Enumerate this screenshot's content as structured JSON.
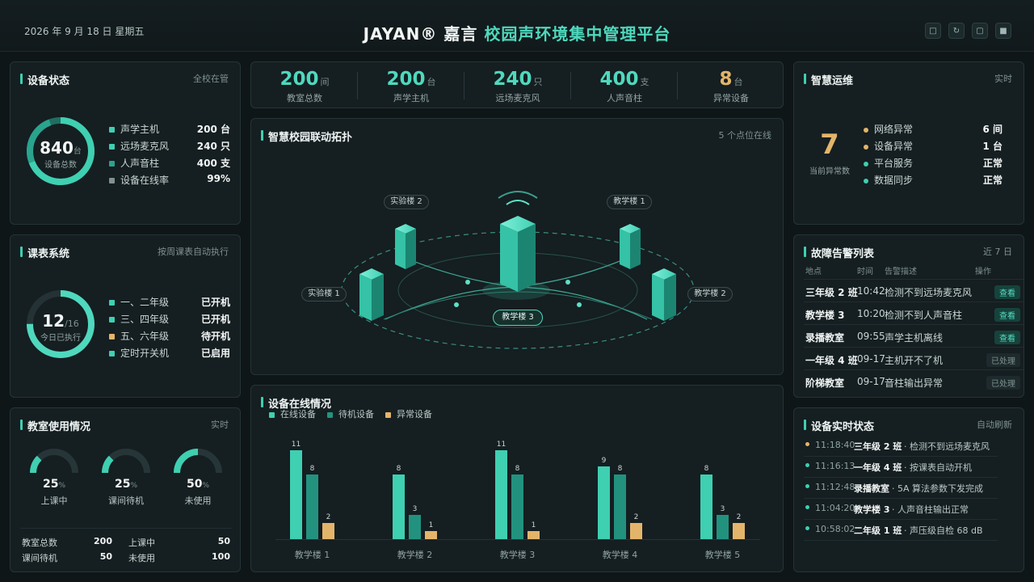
{
  "header": {
    "date": "2026 年 9 月 18 日 星期五",
    "brand": "JAYAN® 嘉言",
    "title": "校园声环境集中管理平台",
    "icons": [
      "square-icon",
      "refresh-icon",
      "window-icon",
      "fullscreen-icon"
    ]
  },
  "device_status": {
    "title": "设备状态",
    "sub": "全校在管",
    "total": "840",
    "total_unit": "台",
    "total_label": "设备总数",
    "items": [
      {
        "label": "声学主机",
        "value": "200 台",
        "color": "#3fcfb1"
      },
      {
        "label": "远场麦克风",
        "value": "240 只",
        "color": "#3fcfb1"
      },
      {
        "label": "人声音柱",
        "value": "400 支",
        "color": "#2aa38d"
      },
      {
        "label": "设备在线率",
        "value": "99%",
        "color": "#7f9290"
      }
    ]
  },
  "schedule": {
    "title": "课表系统",
    "sub": "按周课表自动执行",
    "done": "12",
    "total": "/16",
    "label": "今日已执行",
    "progress": 0.75,
    "items": [
      {
        "label": "一、二年级",
        "value": "已开机",
        "color": "#3fcfb1"
      },
      {
        "label": "三、四年级",
        "value": "已开机",
        "color": "#3fcfb1"
      },
      {
        "label": "五、六年级",
        "value": "待开机",
        "color": "#e3b56a"
      },
      {
        "label": "定时开关机",
        "value": "已启用",
        "color": "#3fcfb1"
      }
    ]
  },
  "classroom_usage": {
    "title": "教室使用情况",
    "sub": "实时",
    "gauges": [
      {
        "value": "25",
        "pct": "%",
        "label": "上课中",
        "fraction": 0.25
      },
      {
        "value": "25",
        "pct": "%",
        "label": "课间待机",
        "fraction": 0.25
      },
      {
        "value": "50",
        "pct": "%",
        "label": "未使用",
        "fraction": 0.5
      }
    ],
    "summary": [
      {
        "label": "教室总数",
        "value": "200"
      },
      {
        "label": "上课中",
        "value": "50"
      },
      {
        "label": "课间待机",
        "value": "50"
      },
      {
        "label": "未使用",
        "value": "100"
      }
    ]
  },
  "stats": [
    {
      "num": "200",
      "unit": "间",
      "label": "教室总数",
      "color": "#4fd8bd"
    },
    {
      "num": "200",
      "unit": "台",
      "label": "声学主机",
      "color": "#4fd8bd"
    },
    {
      "num": "240",
      "unit": "只",
      "label": "远场麦克风",
      "color": "#4fd8bd"
    },
    {
      "num": "400",
      "unit": "支",
      "label": "人声音柱",
      "color": "#4fd8bd"
    },
    {
      "num": "8",
      "unit": "台",
      "label": "异常设备",
      "color": "#e3b56a"
    }
  ],
  "topology": {
    "title": "智慧校园联动拓扑",
    "sub": "5 个点位在线",
    "nodes": {
      "lab2": "实验楼 2",
      "teach1": "教学楼 1",
      "lab1": "实验楼 1",
      "teach2": "教学楼 2",
      "teach3": "教学楼 3"
    }
  },
  "online": {
    "title": "设备在线情况",
    "legend": [
      {
        "label": "在线设备",
        "color": "#3fcfb1"
      },
      {
        "label": "待机设备",
        "color": "#22927f"
      },
      {
        "label": "异常设备",
        "color": "#e3b56a"
      }
    ]
  },
  "chart_data": {
    "type": "bar",
    "title": "设备在线情况",
    "categories": [
      "教学楼 1",
      "教学楼 2",
      "教学楼 3",
      "教学楼 4",
      "教学楼 5"
    ],
    "series": [
      {
        "name": "在线设备",
        "values": [
          11,
          8,
          11,
          9,
          8
        ],
        "color": "#3fcfb1"
      },
      {
        "name": "待机设备",
        "values": [
          8,
          3,
          8,
          8,
          3
        ],
        "color": "#22927f"
      },
      {
        "name": "异常设备",
        "values": [
          2,
          1,
          1,
          2,
          2
        ],
        "color": "#e3b56a"
      }
    ],
    "ylim": [
      0,
      12
    ],
    "grid": false,
    "legend": "top-left"
  },
  "ops": {
    "title": "智慧运维",
    "sub": "实时",
    "count": "7",
    "count_label": "当前异常数",
    "items": [
      {
        "label": "网络异常",
        "value": "6 间",
        "color": "#e3b56a"
      },
      {
        "label": "设备异常",
        "value": "1 台",
        "color": "#e3b56a"
      },
      {
        "label": "平台服务",
        "value": "正常",
        "color": "#3fcfb1"
      },
      {
        "label": "数据同步",
        "value": "正常",
        "color": "#3fcfb1"
      }
    ]
  },
  "alarms": {
    "title": "故障告警列表",
    "sub": "近 7 日",
    "headers": [
      "地点",
      "时间",
      "告警描述",
      "操作"
    ],
    "rows": [
      {
        "place": "三年级 2 班",
        "time": "10:42",
        "desc": "检测不到远场麦克风",
        "action": "查看",
        "state": "view"
      },
      {
        "place": "教学楼 3",
        "time": "10:20",
        "desc": "检测不到人声音柱",
        "action": "查看",
        "state": "view"
      },
      {
        "place": "录播教室",
        "time": "09:55",
        "desc": "声学主机离线",
        "action": "查看",
        "state": "view"
      },
      {
        "place": "一年级 4 班",
        "time": "09-17",
        "desc": "主机开不了机",
        "action": "已处理",
        "state": "done"
      },
      {
        "place": "阶梯教室",
        "time": "09-17",
        "desc": "音柱输出异常",
        "action": "已处理",
        "state": "done"
      }
    ]
  },
  "realtime": {
    "title": "设备实时状态",
    "sub": "自动刷新",
    "rows": [
      {
        "time": "11:18:40",
        "place": "三年级 2 班",
        "msg": "· 检测不到远场麦克风",
        "color": "#e3b56a"
      },
      {
        "time": "11:16:13",
        "place": "一年级 4 班",
        "msg": "· 按课表自动开机",
        "color": "#3fcfb1"
      },
      {
        "time": "11:12:48",
        "place": "录播教室",
        "msg": "· 5A 算法参数下发完成",
        "color": "#3fcfb1"
      },
      {
        "time": "11:04:20",
        "place": "教学楼 3",
        "msg": "· 人声音柱输出正常",
        "color": "#3fcfb1"
      },
      {
        "time": "10:58:02",
        "place": "二年级 1 班",
        "msg": "· 声压级自检 68 dB",
        "color": "#3fcfb1"
      }
    ]
  }
}
